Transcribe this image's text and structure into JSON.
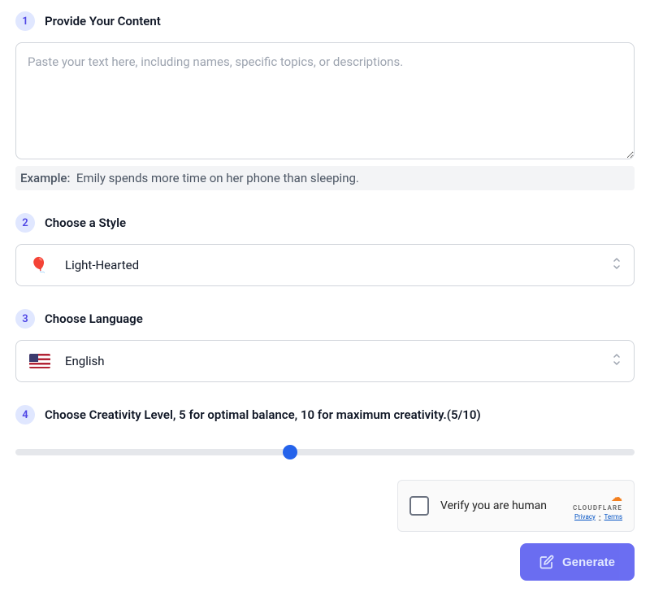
{
  "steps": {
    "content": {
      "num": "1",
      "title": "Provide Your Content",
      "placeholder": "Paste your text here, including names, specific topics, or descriptions.",
      "example_label": "Example:",
      "example_text": "Emily spends more time on her phone than sleeping."
    },
    "style": {
      "num": "2",
      "title": "Choose a Style",
      "icon": "🎈",
      "selected": "Light-Hearted"
    },
    "language": {
      "num": "3",
      "title": "Choose Language",
      "selected": "English"
    },
    "creativity": {
      "num": "4",
      "title": "Choose Creativity Level, 5 for optimal balance, 10 for maximum creativity.(5/10)",
      "value": 5,
      "min": 1,
      "max": 10
    }
  },
  "captcha": {
    "text": "Verify you are human",
    "brand": "CLOUDFLARE",
    "privacy": "Privacy",
    "terms": "Terms"
  },
  "actions": {
    "generate_label": "Generate"
  }
}
